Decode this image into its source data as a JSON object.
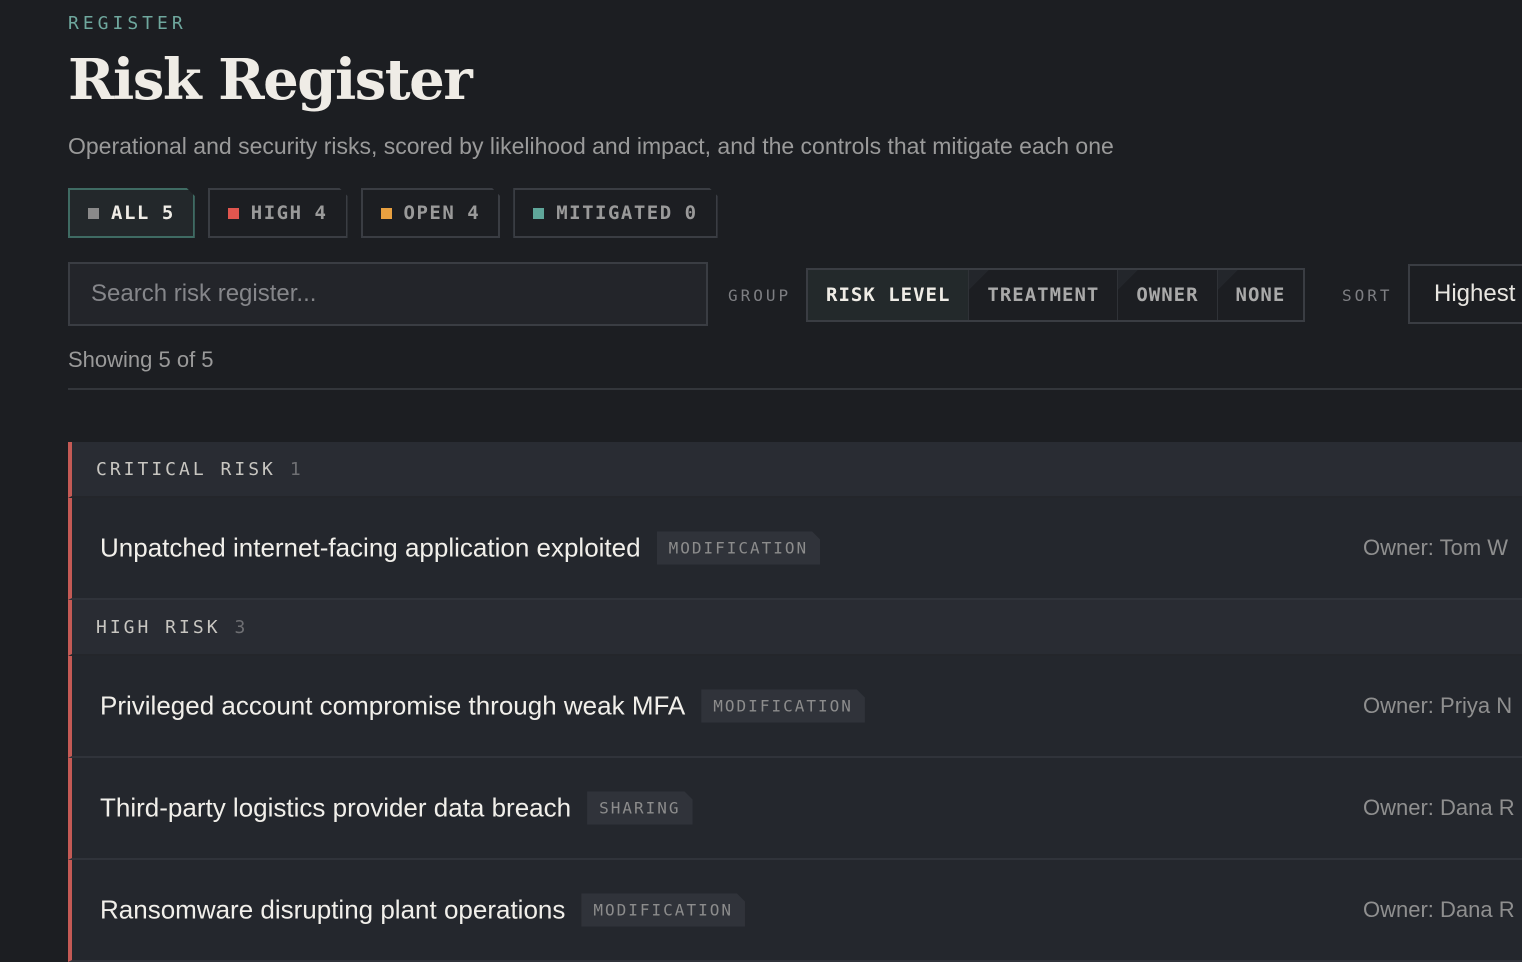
{
  "header": {
    "eyebrow": "REGISTER",
    "title": "Risk Register",
    "subtitle": "Operational and security risks, scored by likelihood and impact, and the controls that mitigate each one"
  },
  "filters": [
    {
      "label": "ALL",
      "count": "5",
      "color": "#8a8a8a",
      "active": true
    },
    {
      "label": "HIGH",
      "count": "4",
      "color": "#e0564f"
    },
    {
      "label": "OPEN",
      "count": "4",
      "color": "#e8a040"
    },
    {
      "label": "MITIGATED",
      "count": "0",
      "color": "#5fa69a"
    }
  ],
  "search": {
    "placeholder": "Search risk register..."
  },
  "group_by": {
    "label": "GROUP",
    "options": [
      "RISK LEVEL",
      "TREATMENT",
      "OWNER",
      "NONE"
    ],
    "selected": "RISK LEVEL"
  },
  "sort": {
    "label": "SORT",
    "value": "Highest"
  },
  "showing": "Showing 5 of 5",
  "groups": [
    {
      "name": "CRITICAL RISK",
      "count": "1",
      "accent": "#c45a55",
      "items": [
        {
          "title": "Unpatched internet-facing application exploited",
          "tag": "MODIFICATION",
          "owner": "Owner: Tom W"
        }
      ]
    },
    {
      "name": "HIGH RISK",
      "count": "3",
      "accent": "#c45a55",
      "items": [
        {
          "title": "Privileged account compromise through weak MFA",
          "tag": "MODIFICATION",
          "owner": "Owner: Priya N"
        },
        {
          "title": "Third-party logistics provider data breach",
          "tag": "SHARING",
          "owner": "Owner: Dana R"
        },
        {
          "title": "Ransomware disrupting plant operations",
          "tag": "MODIFICATION",
          "owner": "Owner: Dana R"
        }
      ]
    }
  ]
}
